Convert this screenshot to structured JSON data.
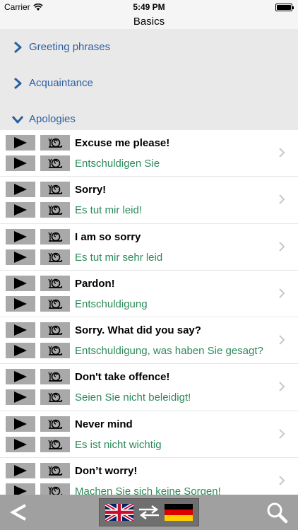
{
  "status": {
    "carrier": "Carrier",
    "time": "5:49 PM",
    "battery_level": 1.0
  },
  "nav": {
    "title": "Basics"
  },
  "categories": [
    {
      "label": "Greeting phrases",
      "expanded": false
    },
    {
      "label": "Acquaintance",
      "expanded": false
    },
    {
      "label": "Apologies",
      "expanded": true
    }
  ],
  "phrases": [
    {
      "en": "Excuse me please!",
      "de": "Entschuldigen Sie"
    },
    {
      "en": "Sorry!",
      "de": "Es tut mir leid!"
    },
    {
      "en": "I am so sorry",
      "de": "Es tut mir sehr leid"
    },
    {
      "en": "Pardon!",
      "de": "Entschuldigung"
    },
    {
      "en": "Sorry. What did you say?",
      "de": "Entschuldigung, was haben Sie gesagt?"
    },
    {
      "en": "Don't take offence!",
      "de": "Seien Sie nicht beleidigt!"
    },
    {
      "en": "Never mind",
      "de": "Es ist nicht wichtig"
    },
    {
      "en": "Don’t worry!",
      "de": "Machen Sie sich keine Sorgen!"
    }
  ],
  "toolbar": {
    "back_icon": "back-arrow-icon",
    "search_icon": "magnifier-icon",
    "lang_icons": [
      "uk-flag-icon",
      "swap-arrows-icon",
      "german-flag-icon"
    ]
  },
  "colors": {
    "category_text": "#2a5fa0",
    "translation_text": "#2c8a5a",
    "category_bg": "#e9e9e9",
    "toolbar_bg": "#a0a0a0",
    "button_bg": "#a9a9a9"
  }
}
